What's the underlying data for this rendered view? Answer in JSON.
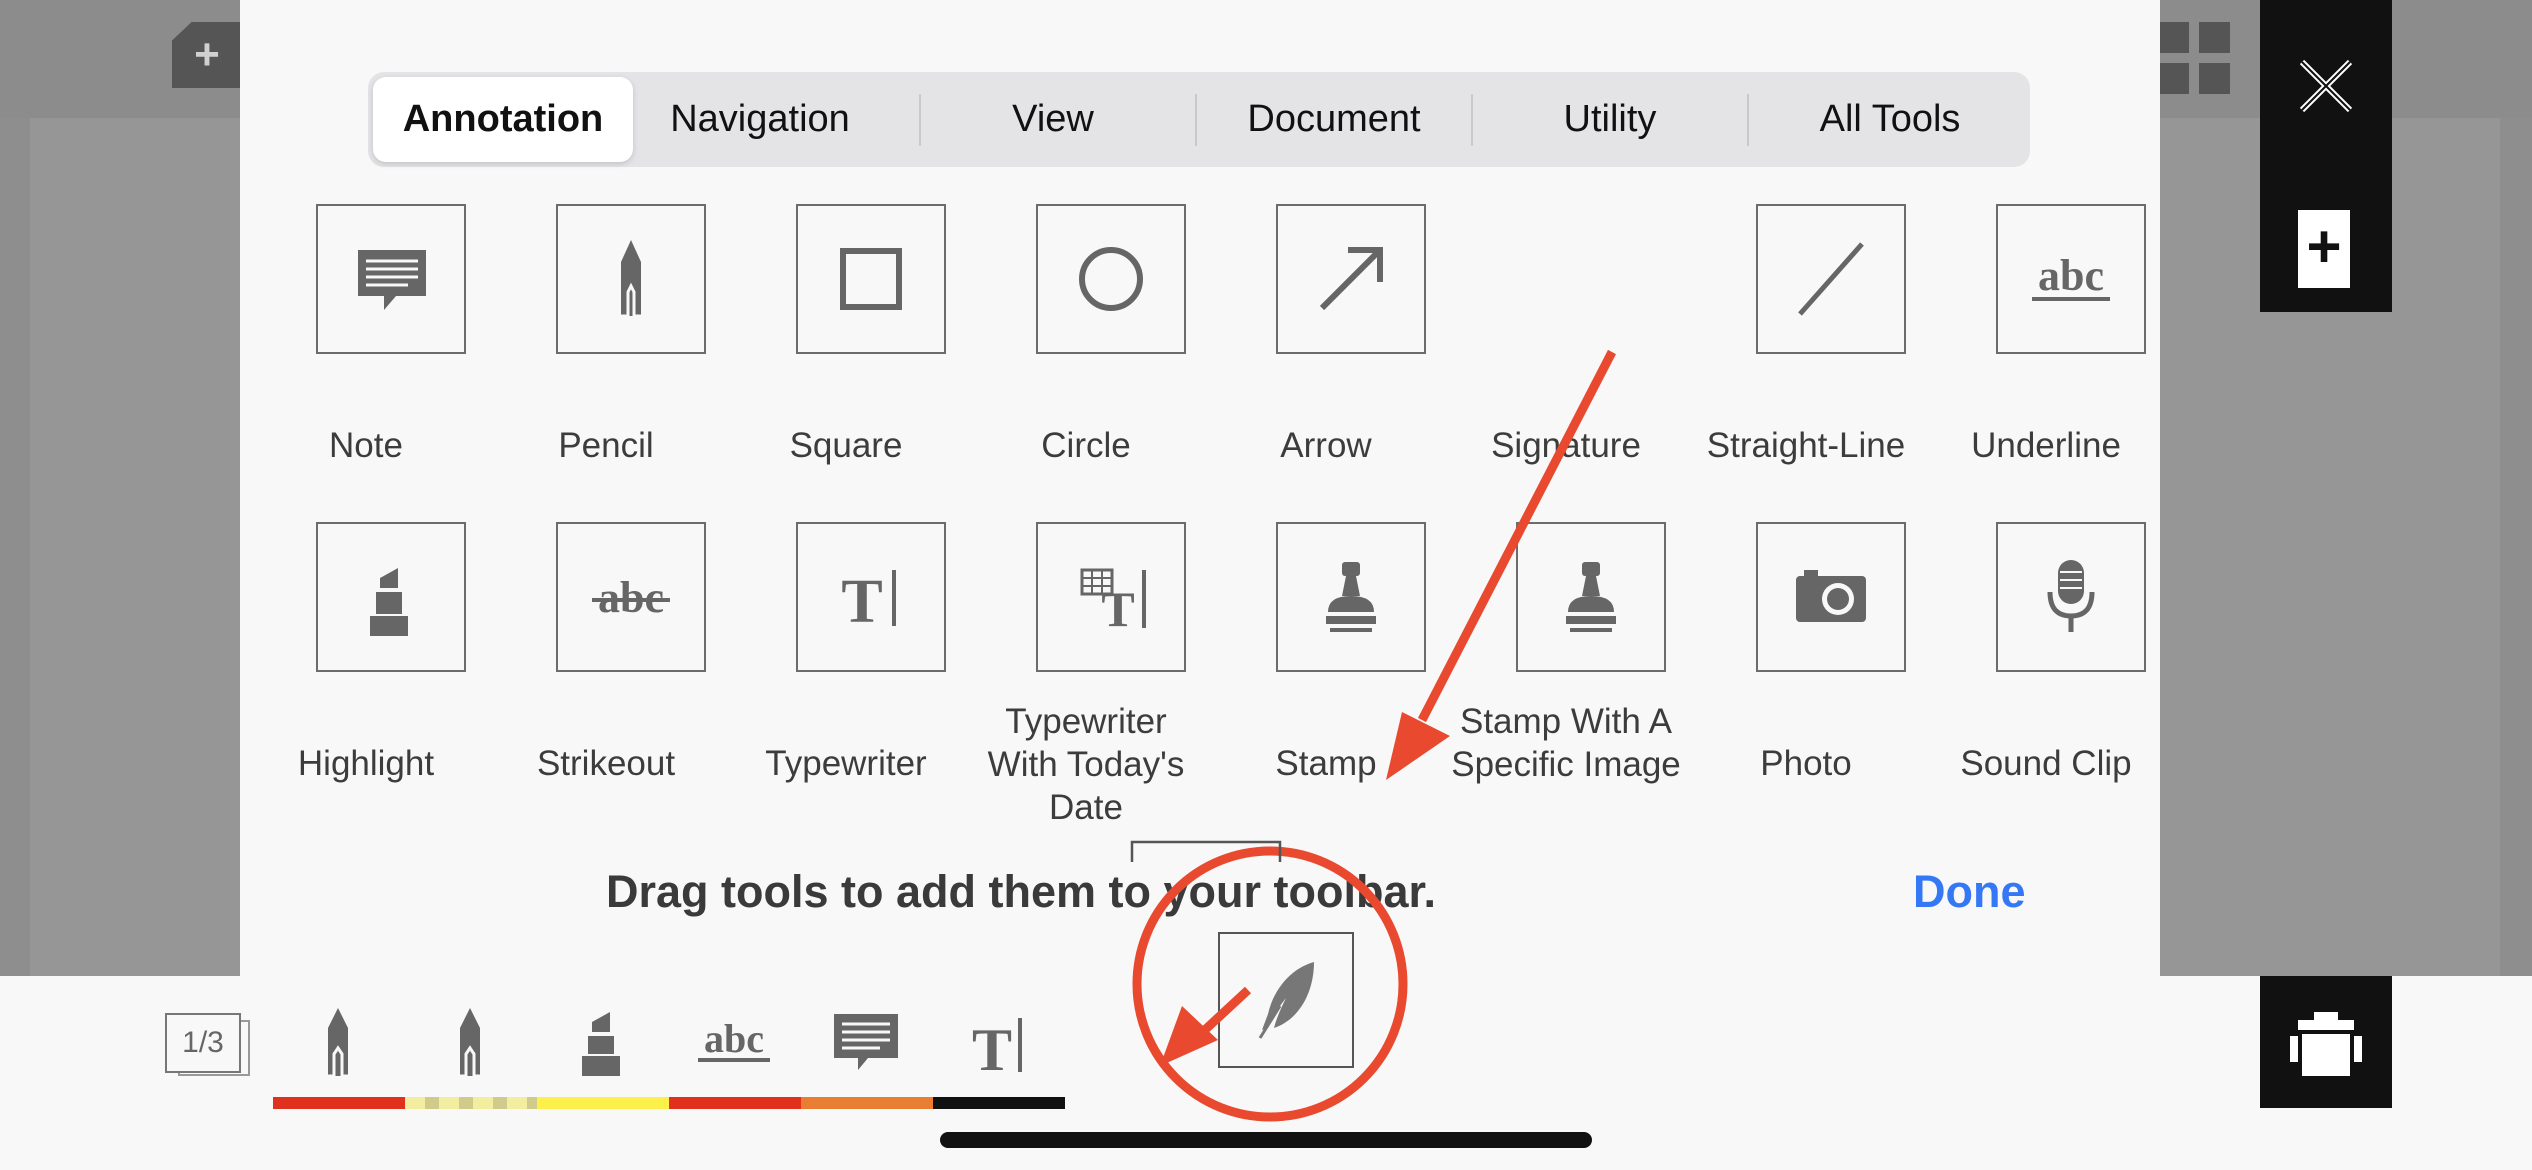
{
  "tabs": [
    {
      "label": "Annotation",
      "active": true
    },
    {
      "label": "Navigation",
      "active": false
    },
    {
      "label": "View",
      "active": false
    },
    {
      "label": "Document",
      "active": false
    },
    {
      "label": "Utility",
      "active": false
    },
    {
      "label": "All Tools",
      "active": false
    }
  ],
  "tools_row1": [
    {
      "label": "Note",
      "icon": "note-icon"
    },
    {
      "label": "Pencil",
      "icon": "pencil-icon"
    },
    {
      "label": "Square",
      "icon": "square-icon"
    },
    {
      "label": "Circle",
      "icon": "circle-icon"
    },
    {
      "label": "Arrow",
      "icon": "arrow-icon"
    },
    {
      "label": "Signature",
      "icon": "signature-icon"
    },
    {
      "label": "Straight-Line",
      "icon": "straight-line-icon"
    },
    {
      "label": "Underline",
      "icon": "underline-icon"
    }
  ],
  "tools_row2": [
    {
      "label": "Highlight",
      "icon": "highlight-icon"
    },
    {
      "label": "Strikeout",
      "icon": "strikeout-icon"
    },
    {
      "label": "Typewriter",
      "icon": "typewriter-icon"
    },
    {
      "label": "Typewriter With Today's Date",
      "icon": "typewriter-date-icon"
    },
    {
      "label": "Stamp",
      "icon": "stamp-icon"
    },
    {
      "label": "Stamp With A Specific Image",
      "icon": "stamp-image-icon"
    },
    {
      "label": "Photo",
      "icon": "camera-icon"
    },
    {
      "label": "Sound Clip",
      "icon": "microphone-icon"
    }
  ],
  "icon_text": {
    "underline": "abc",
    "strikeout": "abc",
    "typewriter": "T"
  },
  "hint": "Drag tools to add them to your toolbar.",
  "done_label": "Done",
  "page_indicator": "1/3",
  "toolbar_items": [
    {
      "icon": "pencil-icon",
      "underline_color": "#e0301e"
    },
    {
      "icon": "pencil-icon",
      "underline_color": "#e8e19a"
    },
    {
      "icon": "highlight-icon",
      "underline_color": "#fdf04b"
    },
    {
      "icon": "underline-icon",
      "underline_color": "#e0301e"
    },
    {
      "icon": "note-icon",
      "underline_color": "#ea7d34"
    },
    {
      "icon": "typewriter-icon",
      "underline_color": "#111111"
    }
  ],
  "dragged_tool": {
    "icon": "quill-icon"
  },
  "colors": {
    "accent": "#3478f6",
    "annotation_red": "#e8492f"
  }
}
